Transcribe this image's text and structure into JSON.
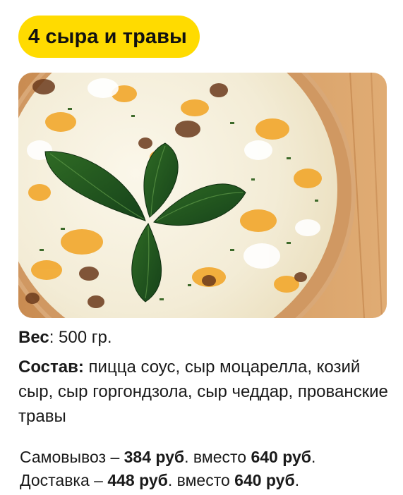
{
  "title": "4 сыра и травы",
  "photo": {
    "icon": "pizza-photo",
    "description_hidden": ""
  },
  "weight": {
    "label": "Вес",
    "value": ": 500 гр."
  },
  "composition": {
    "label": "Состав:",
    "value": " пицца соус, сыр моцарелла, козий сыр, сыр горгондзола, сыр чеддар, прованские травы"
  },
  "prices": [
    {
      "method": "Самовывоз – ",
      "price": "384 руб",
      "middle": ". вместо ",
      "old_price": "640 руб",
      "end": "."
    },
    {
      "method": "Доставка – ",
      "price": "448 руб",
      "middle": ". вместо ",
      "old_price": "640 руб",
      "end": "."
    }
  ],
  "colors": {
    "title_bg": "#ffdb00",
    "text": "#1a1a1a"
  }
}
